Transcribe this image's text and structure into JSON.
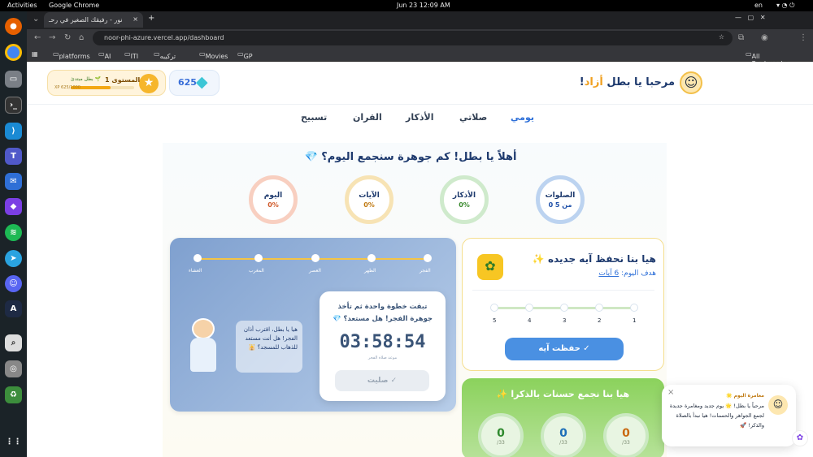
{
  "system": {
    "activities": "Activities",
    "app": "Google Chrome",
    "datetime": "Jun 23  12:09 AM",
    "lang": "en"
  },
  "browser": {
    "tab_title": "نور - رفيقك الصغير في رحـ",
    "url": "noor-phi-azure.vercel.app/dashboard",
    "bookmarks": [
      "platforms",
      "AI",
      "ITI",
      "تركيبه نفسيه",
      "Movies",
      "GP"
    ],
    "all_bookmarks": "All Bookmarks"
  },
  "header": {
    "greeting_prefix": "مرحبا يا بطل",
    "name": "أزاد",
    "exclaim": "!",
    "gems": "625",
    "level_label": "المستوى 1",
    "rank": "بطل مبتدئ 🌱",
    "xp": "XP 625/1000",
    "level_num": "1",
    "xp_fraction": 0.625
  },
  "nav": {
    "tabs": [
      "يومي",
      "صلاتي",
      "الأذكار",
      "القران",
      "تسبيح"
    ],
    "active": 0
  },
  "hero": {
    "title": "أهلاً يا بطل! كم جوهرة سنجمع اليوم؟ 💎"
  },
  "stats": [
    {
      "label": "الصلوات",
      "value": "0 من 5",
      "color": "#bcd3f0",
      "text": "#1e4fa8"
    },
    {
      "label": "الأذكار",
      "value": "0%",
      "color": "#cfeacc",
      "text": "#3a8a2e"
    },
    {
      "label": "الآيات",
      "value": "0%",
      "color": "#f7e3b4",
      "text": "#c07a12"
    },
    {
      "label": "اليوم",
      "value": "0%",
      "color": "#f8cfc0",
      "text": "#d05a2a"
    }
  ],
  "prayer": {
    "steps": [
      "الفجر",
      "الظهر",
      "العصر",
      "المغرب",
      "العشاء"
    ],
    "heading": "تبقت خطوة واحدة ثم تأخذ جوهرة الفجر! هل مستعد؟ 💎",
    "countdown": "03:58:54",
    "countdown_label": "موعد صلاة الفجر",
    "button": "صليت",
    "bubble": "هيا يا بطل، اقترب أذان الفجر! هل أنت مستعد للذهاب للمسجد؟ 🕌"
  },
  "quran": {
    "title": "هيا بنا نحفظ آيه جديده ✨",
    "goal_label": "هدف اليوم:",
    "goal_value": "6 آيات",
    "ticks": [
      "1",
      "2",
      "3",
      "4",
      "5"
    ],
    "button": "حفظت آيه"
  },
  "adhkar": {
    "title": "هيا بنا نجمع حسنات بالذكرا ✨",
    "counters": [
      {
        "value": "0",
        "max": "/33"
      },
      {
        "value": "0",
        "max": "/33"
      },
      {
        "value": "0",
        "max": "/33"
      }
    ]
  },
  "popup": {
    "title": "مغامرة اليوم 🌟",
    "body": "مرحباً يا بطل! 🌟 يوم جديد ومغامرة جديدة لجمع الجواهر والحسنات! هيا نبدأ بالصلاة والذكر! 🚀",
    "close": "×"
  }
}
